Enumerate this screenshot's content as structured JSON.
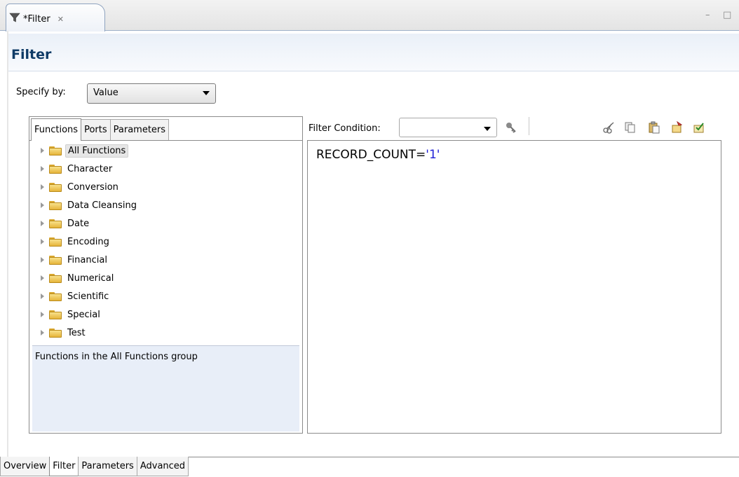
{
  "editor_tab": {
    "title": "*Filter",
    "close": "✕"
  },
  "window_controls": {
    "minimize": "–",
    "maximize": "□"
  },
  "page": {
    "title": "Filter"
  },
  "specify": {
    "label": "Specify by:",
    "value": "Value"
  },
  "left_tabs": [
    {
      "label": "Functions",
      "active": true
    },
    {
      "label": "Ports",
      "active": false
    },
    {
      "label": "Parameters",
      "active": false
    }
  ],
  "tree": [
    {
      "label": "All Functions",
      "selected": true
    },
    {
      "label": "Character"
    },
    {
      "label": "Conversion"
    },
    {
      "label": "Data Cleansing"
    },
    {
      "label": "Date"
    },
    {
      "label": "Encoding"
    },
    {
      "label": "Financial"
    },
    {
      "label": "Numerical"
    },
    {
      "label": "Scientific"
    },
    {
      "label": "Special"
    },
    {
      "label": "Test"
    }
  ],
  "description": "Functions in the All Functions group",
  "filter_condition": {
    "label": "Filter Condition:",
    "value": ""
  },
  "toolbar_icons": [
    "key-icon",
    "cut-icon",
    "copy-icon",
    "paste-icon",
    "insert-icon",
    "validate-icon"
  ],
  "expression": {
    "field": "RECORD_COUNT",
    "operator": "=",
    "literal": "'1'"
  },
  "bottom_tabs": [
    {
      "label": "Overview",
      "active": false
    },
    {
      "label": "Filter",
      "active": true
    },
    {
      "label": "Parameters",
      "active": false
    },
    {
      "label": "Advanced",
      "active": false
    }
  ],
  "colors": {
    "title": "#0f3b66",
    "literal": "#1f1fd6",
    "description_bg": "#e8eef8"
  }
}
